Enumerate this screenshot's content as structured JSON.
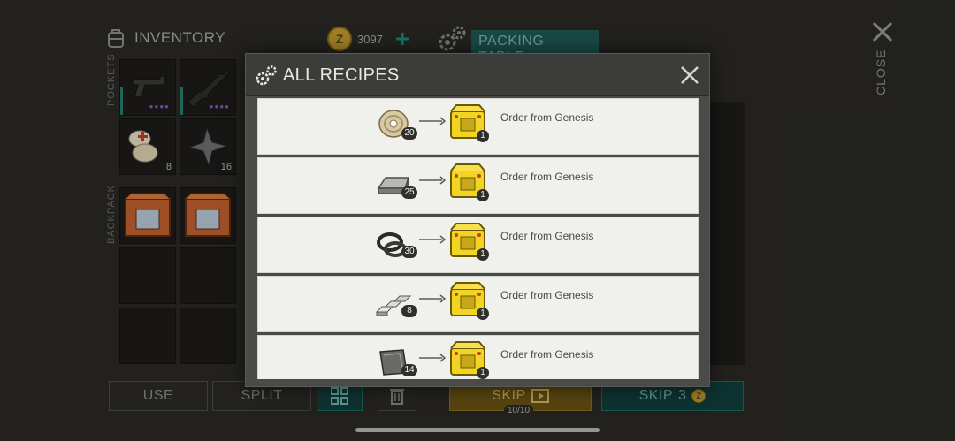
{
  "inventory": {
    "title": "INVENTORY",
    "coins": "3097",
    "add_symbol": "+",
    "packing_table": "PACKING TABLE",
    "pockets_label": "POCKETS",
    "backpack_label": "BACKPACK",
    "close_label": "CLOSE",
    "slots": [
      {
        "icon": "pistol-icon",
        "count": ""
      },
      {
        "icon": "rifle-icon",
        "count": ""
      },
      {
        "icon": "bandage-icon",
        "count": "8"
      },
      {
        "icon": "shuriken-icon",
        "count": "16"
      },
      {
        "icon": "crate-icon",
        "count": ""
      },
      {
        "icon": "crate-icon",
        "count": ""
      }
    ],
    "buttons": {
      "use": "USE",
      "split": "SPLIT",
      "skip_video": "SKIP",
      "skip_counter": "10/10",
      "skip_coin": "SKIP",
      "skip_coin_cost": "3"
    }
  },
  "modal": {
    "title": "ALL RECIPES",
    "recipes": [
      {
        "ingredient_icon": "wire-spool-icon",
        "ingredient_count": "20",
        "result_icon": "yellow-crate-icon",
        "result_count": "1",
        "name": "Order from Genesis"
      },
      {
        "ingredient_icon": "metal-bar-icon",
        "ingredient_count": "25",
        "result_icon": "yellow-crate-icon",
        "result_count": "1",
        "name": "Order from Genesis"
      },
      {
        "ingredient_icon": "rubber-ring-icon",
        "ingredient_count": "30",
        "result_icon": "yellow-crate-icon",
        "result_count": "1",
        "name": "Order from Genesis"
      },
      {
        "ingredient_icon": "aluminum-ingot-icon",
        "ingredient_count": "8",
        "result_icon": "yellow-crate-icon",
        "result_count": "1",
        "name": "Order from Genesis"
      },
      {
        "ingredient_icon": "metal-plate-icon",
        "ingredient_count": "14",
        "result_icon": "yellow-crate-icon",
        "result_count": "1",
        "name": "Order from Genesis"
      }
    ]
  },
  "colors": {
    "modal_bg": "#4a4b48",
    "row_bg": "#f0f0ec",
    "accent_teal": "#1f5a55",
    "accent_yellow": "#6a5314"
  }
}
